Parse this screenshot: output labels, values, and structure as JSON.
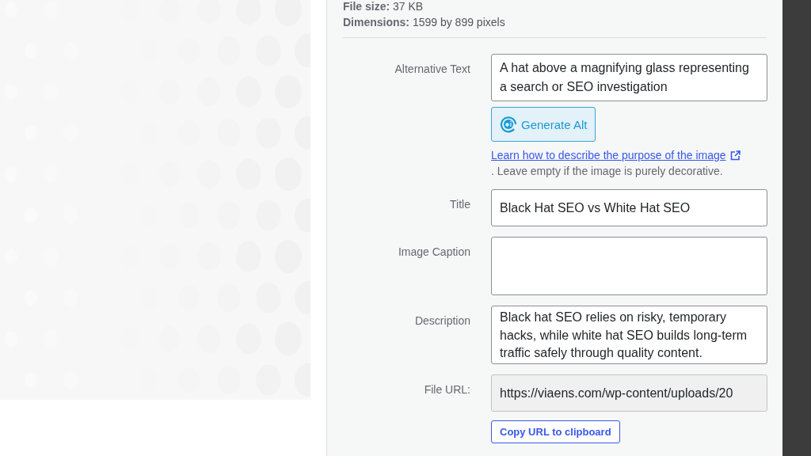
{
  "file_info": [
    {
      "label": "File size:",
      "value": "37 KB"
    },
    {
      "label": "Dimensions:",
      "value": "1599 by 899 pixels"
    }
  ],
  "fields": [
    {
      "label": "Alternative Text",
      "kind": "textarea",
      "value": "A hat above a magnifying glass representing a search or SEO investigation",
      "actions": [
        {
          "kind": "ai-button",
          "label": "Generate Alt"
        },
        {
          "kind": "link",
          "label": "Learn how to describe the purpose of the image"
        },
        {
          "kind": "note",
          "label": ". Leave empty if the image is purely decorative."
        }
      ]
    },
    {
      "label": "Title",
      "kind": "input",
      "value": "Black Hat SEO vs White Hat SEO"
    },
    {
      "label": "Image Caption",
      "kind": "textarea"
    },
    {
      "label": "Description",
      "kind": "textarea",
      "value": "Black hat SEO relies on risky, temporary hacks, while white hat SEO builds long-term traffic safely through quality content."
    },
    {
      "label": "File URL:",
      "kind": "readonly",
      "value": "https://viaens.com/wp-content/uploads/20",
      "actions": [
        {
          "kind": "outline-button",
          "label": "Copy URL to clipboard"
        }
      ]
    }
  ]
}
